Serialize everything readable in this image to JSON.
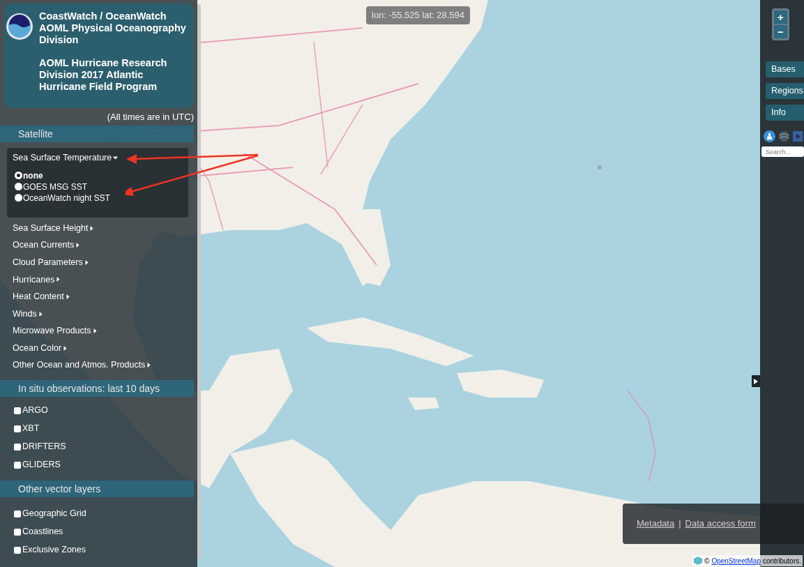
{
  "header": {
    "title": "CoastWatch / OceanWatch AOML Physical Oceanography Division",
    "subtitle": "AOML Hurricane Research Division 2017 Atlantic Hurricane Field Program",
    "time_note": "(All times are in UTC)"
  },
  "satellite": {
    "heading": "Satellite",
    "menus": [
      {
        "label": "Sea Surface Temperature",
        "expanded": true,
        "options": [
          {
            "label": "none",
            "selected": true
          },
          {
            "label": "GOES MSG SST",
            "selected": false
          },
          {
            "label": "OceanWatch night SST",
            "selected": false
          }
        ]
      },
      {
        "label": "Sea Surface Height",
        "expanded": false
      },
      {
        "label": "Ocean Currents",
        "expanded": false
      },
      {
        "label": "Cloud Parameters",
        "expanded": false
      },
      {
        "label": "Hurricanes",
        "expanded": false
      },
      {
        "label": "Heat Content",
        "expanded": false
      },
      {
        "label": "Winds",
        "expanded": false
      },
      {
        "label": "Microwave Products",
        "expanded": false
      },
      {
        "label": "Ocean Color",
        "expanded": false
      },
      {
        "label": "Other Ocean and Atmos. Products",
        "expanded": false
      }
    ]
  },
  "in_situ": {
    "heading": "In situ observations: last 10 days",
    "layers": [
      {
        "label": "ARGO",
        "checked": false
      },
      {
        "label": "XBT",
        "checked": false
      },
      {
        "label": "DRIFTERS",
        "checked": false
      },
      {
        "label": "GLIDERS",
        "checked": false
      }
    ]
  },
  "vector_layers": {
    "heading": "Other vector layers",
    "layers": [
      {
        "label": "Geographic Grid",
        "checked": false
      },
      {
        "label": "Coastlines",
        "checked": false
      },
      {
        "label": "Exclusive Zones",
        "checked": false
      }
    ]
  },
  "map": {
    "coordinates": "lon: -55.525 lat: 28.594"
  },
  "toolbar": {
    "zoom_in": "+",
    "zoom_out": "−",
    "buttons": [
      "Bases",
      "Regions",
      "Info"
    ],
    "search": {
      "placeholder": "Search..."
    }
  },
  "footer": {
    "links": [
      "Metadata",
      "Data access form"
    ],
    "separator": "|"
  },
  "attribution": {
    "symbol": "©",
    "link": "OpenStreetMap",
    "text": "contributors."
  }
}
